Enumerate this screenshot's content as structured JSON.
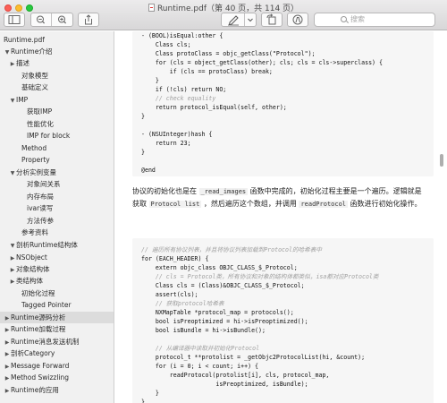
{
  "window": {
    "title": "Runtime.pdf（第 40 页，共 114 页）"
  },
  "toolbar": {
    "search_placeholder": "搜索",
    "icons": [
      "sidebar-toggle-icon",
      "zoom-out-icon",
      "zoom-in-icon",
      "share-icon",
      "pen-markup-icon",
      "chevron-down-icon",
      "rotate-icon",
      "annotate-icon"
    ]
  },
  "sidebar": {
    "items": [
      {
        "label": "Runtime.pdf",
        "expander": ""
      },
      {
        "label": "Runtime介绍",
        "expander": "▼"
      },
      {
        "label": "描述",
        "expander": "▶"
      },
      {
        "label": "对象模型",
        "expander": ""
      },
      {
        "label": "基础定义",
        "expander": ""
      },
      {
        "label": "IMP",
        "expander": "▼"
      },
      {
        "label": "获取IMP",
        "expander": ""
      },
      {
        "label": "性能优化",
        "expander": ""
      },
      {
        "label": "IMP for block",
        "expander": ""
      },
      {
        "label": "Method",
        "expander": ""
      },
      {
        "label": "Property",
        "expander": ""
      },
      {
        "label": "分析实例变量",
        "expander": "▼"
      },
      {
        "label": "对象间关系",
        "expander": ""
      },
      {
        "label": "内存布局",
        "expander": ""
      },
      {
        "label": "ivar读写",
        "expander": ""
      },
      {
        "label": "方法传参",
        "expander": ""
      },
      {
        "label": "参考资料",
        "expander": ""
      },
      {
        "label": "剖析Runtime结构体",
        "expander": "▼"
      },
      {
        "label": "NSObject",
        "expander": "▶"
      },
      {
        "label": "对象结构体",
        "expander": "▶"
      },
      {
        "label": "类结构体",
        "expander": "▶"
      },
      {
        "label": "初始化过程",
        "expander": ""
      },
      {
        "label": "Tagged Pointer",
        "expander": ""
      },
      {
        "label": "Runtime源码分析",
        "expander": "▶"
      },
      {
        "label": "Runtime加载过程",
        "expander": "▶"
      },
      {
        "label": "Runtime消息发送机制",
        "expander": "▶"
      },
      {
        "label": "剖析Category",
        "expander": "▶"
      },
      {
        "label": "Message Forward",
        "expander": "▶"
      },
      {
        "label": "Method Swizzling",
        "expander": "▶"
      },
      {
        "label": "Runtime的应用",
        "expander": "▶"
      }
    ],
    "selected_index": 23
  },
  "code_top": {
    "lines": [
      "- (BOOL)isEqual:other {",
      "    Class cls;",
      "    Class protoClass = objc_getClass(\"Protocol\");",
      "    for (cls = object_getClass(other); cls; cls = cls->superclass) {",
      "        if (cls == protoClass) break;",
      "    }",
      "    if (!cls) return NO;",
      "    // check equality",
      "    return protocol_isEqual(self, other);",
      "}",
      "",
      "- (NSUInteger)hash {",
      "    return 23;",
      "}",
      "",
      "@end"
    ]
  },
  "paragraph": {
    "part1": "协议的初始化也是在 ",
    "code1": "_read_images",
    "part2": " 函数中完成的，初始化过程主要是一个遍历。逻辑就是获取 ",
    "code2": "Protocol list",
    "part3": " ，然后遍历这个数组，并调用 ",
    "code3": "readProtocol",
    "part4": " 函数进行初始化操作。"
  },
  "code_bottom": {
    "lines": [
      "// 遍历所有协议列表，并且将协议列表加载到Protocol的哈希表中",
      "for (EACH_HEADER) {",
      "    extern objc_class OBJC_CLASS_$_Protocol;",
      "    // cls = Protocol类，所有协议和对象的结构体都类似，isa都对应Protocol类",
      "    Class cls = (Class)&OBJC_CLASS_$_Protocol;",
      "    assert(cls);",
      "    // 获取protocol哈希表",
      "    NXMapTable *protocol_map = protocols();",
      "    bool isPreoptimized = hi->isPreoptimized();",
      "    bool isBundle = hi->isBundle();",
      "",
      "    // 从编译器中读取并初始化Protocol",
      "    protocol_t **protolist = _getObjc2ProtocolList(hi, &count);",
      "    for (i = 0; i < count; i++) {",
      "        readProtocol(protolist[i], cls, protocol_map,",
      "                     isPreoptimized, isBundle);",
      "    }",
      "}"
    ]
  }
}
